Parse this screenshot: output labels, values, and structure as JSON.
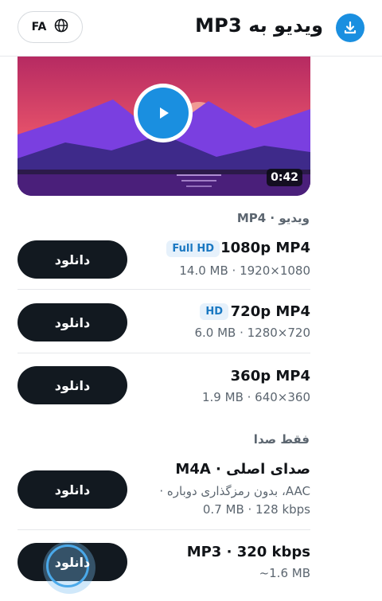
{
  "header": {
    "title": "ویدیو به MP3",
    "lang": "FA",
    "brand_icon": "download-icon",
    "lang_icon": "globe-icon"
  },
  "video": {
    "duration": "0:42",
    "play_icon": "play-icon"
  },
  "sections": {
    "video": "ویدیو · MP4",
    "audio": "فقط صدا"
  },
  "video_formats": [
    {
      "title": "1080p MP4",
      "badge": "Full HD",
      "meta": "14.0 MB · 1920×1080",
      "button": "دانلود"
    },
    {
      "title": "720p MP4",
      "badge": "HD",
      "meta": "6.0 MB · 1280×720",
      "button": "دانلود"
    },
    {
      "title": "360p MP4",
      "meta": "1.9 MB · 640×360",
      "button": "دانلود"
    }
  ],
  "audio_formats": [
    {
      "title": "صدای اصلی · M4A",
      "meta1": "AAC، بدون رمزگذاری دوباره ·",
      "meta2": "0.7 MB · 128 kbps",
      "button": "دانلود"
    },
    {
      "title": "MP3 · 320 kbps",
      "meta": "~1.6 MB",
      "button": "دانلود"
    }
  ],
  "colors": {
    "accent": "#1a8fe0",
    "button_bg": "#121920"
  }
}
